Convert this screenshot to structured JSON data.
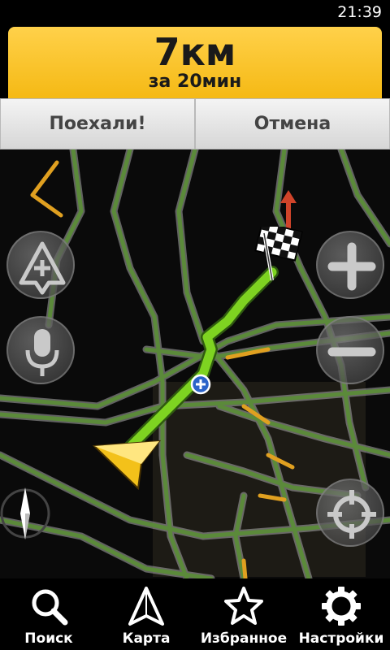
{
  "status": {
    "time": "21:39"
  },
  "route": {
    "distance": "7км",
    "duration": "за 20мин"
  },
  "actions": {
    "go_label": "Поехали!",
    "cancel_label": "Отмена"
  },
  "map": {
    "buttons": [
      "traffic-report-icon",
      "microphone-icon",
      "zoom-in-icon",
      "zoom-out-icon",
      "locate-icon",
      "compass-icon"
    ],
    "route_color": "#7ed321",
    "road_color": "#5b8a3a",
    "jam_color": "#e0a020"
  },
  "tabs": [
    {
      "label": "Поиск",
      "icon": "search-icon"
    },
    {
      "label": "Карта",
      "icon": "map-arrow-icon"
    },
    {
      "label": "Избранное",
      "icon": "star-icon"
    },
    {
      "label": "Настройки",
      "icon": "gear-icon"
    }
  ]
}
